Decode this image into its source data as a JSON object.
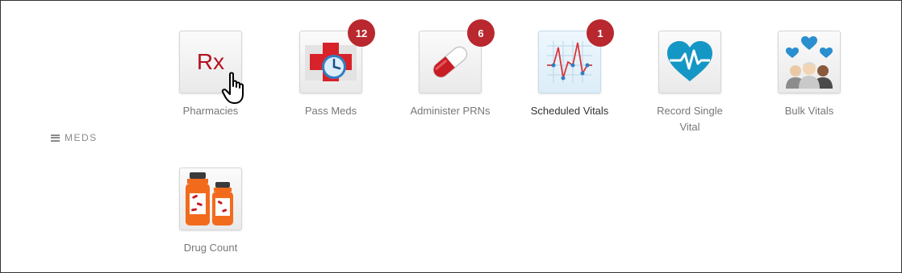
{
  "section": {
    "label": "MEDS",
    "icon": "hamburger-icon"
  },
  "tiles": [
    {
      "label": "Pharmacies",
      "icon": "rx-icon",
      "badge": null
    },
    {
      "label": "Pass Meds",
      "icon": "medical-cross-clock-icon",
      "badge": "12"
    },
    {
      "label": "Administer PRNs",
      "icon": "capsule-icon",
      "badge": "6"
    },
    {
      "label": "Scheduled Vitals",
      "icon": "vitals-chart-icon",
      "badge": "1"
    },
    {
      "label": "Record Single Vital",
      "icon": "heartbeat-icon",
      "badge": null
    },
    {
      "label": "Bulk Vitals",
      "icon": "group-hearts-icon",
      "badge": null
    },
    {
      "label": "Drug Count",
      "icon": "pill-bottles-icon",
      "badge": null
    }
  ],
  "rx_text": "Rx",
  "colors": {
    "badge": "#b8282e",
    "rx": "#b3121f",
    "heart": "#1597c5",
    "bottle": "#f26b1d"
  }
}
